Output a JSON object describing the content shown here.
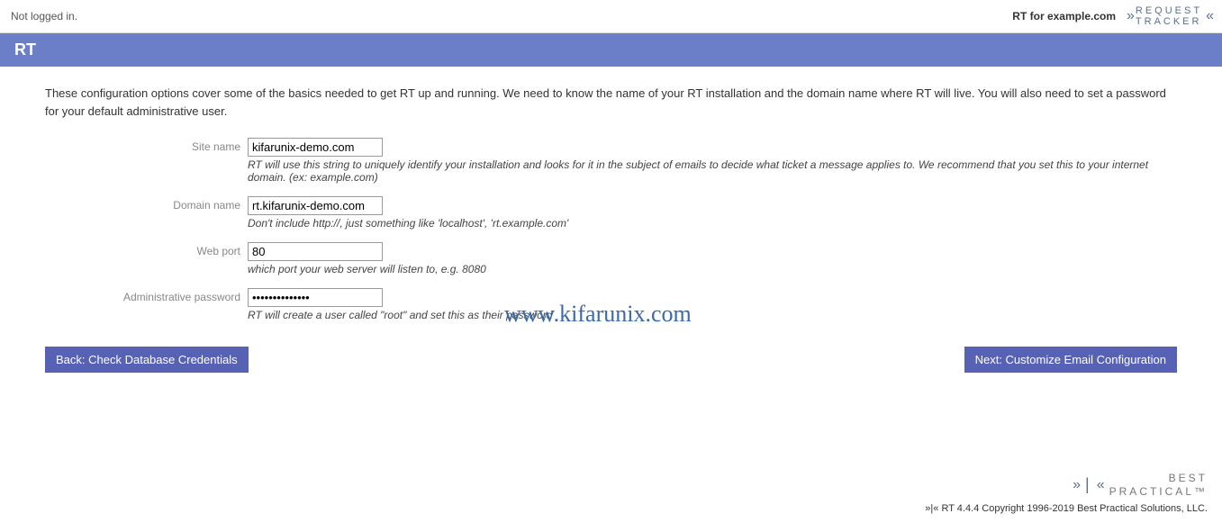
{
  "header": {
    "login_status": "Not logged in.",
    "rt_for": "RT for example.com",
    "logo_line1": "REQUEST",
    "logo_line2": "TRACKER"
  },
  "title_bar": "RT",
  "intro": "These configuration options cover some of the basics needed to get RT up and running. We need to know the name of your RT installation and the domain name where RT will live. You will also need to set a password for your default administrative user.",
  "form": {
    "site_name": {
      "label": "Site name",
      "value": "kifarunix-demo.com",
      "help": "RT will use this string to uniquely identify your installation and looks for it in the subject of emails to decide what ticket a message applies to. We recommend that you set this to your internet domain. (ex: example.com)"
    },
    "domain_name": {
      "label": "Domain name",
      "value": "rt.kifarunix-demo.com",
      "help": "Don't include http://, just something like 'localhost', 'rt.example.com'"
    },
    "web_port": {
      "label": "Web port",
      "value": "80",
      "help": "which port your web server will listen to, e.g. 8080"
    },
    "admin_password": {
      "label": "Administrative password",
      "value": "••••••••••••••",
      "help": "RT will create a user called \"root\" and set this as their password"
    }
  },
  "buttons": {
    "back": "Back: Check Database Credentials",
    "next": "Next: Customize Email Configuration"
  },
  "watermark": "www.kifarunix.com",
  "footer": {
    "bp_line1": "BEST",
    "bp_line2": "PRACTICAL™",
    "copyright": "»|« RT 4.4.4 Copyright 1996-2019 Best Practical Solutions, LLC."
  }
}
